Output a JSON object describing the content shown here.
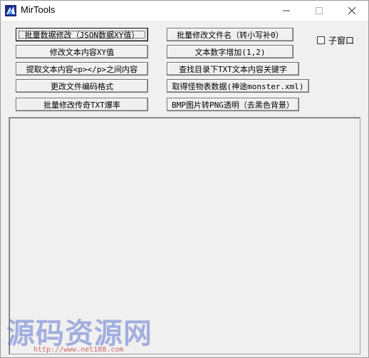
{
  "window": {
    "title": "MirTools"
  },
  "colors": {
    "window_bg": "#f0f0f0",
    "titlebar_bg": "#ffffff",
    "watermark": "#6478d2",
    "watermark_url": "#c84646"
  },
  "buttons": {
    "batch_modify_data": "批量数据修改（JSON数据XY值）",
    "batch_rename": "批量修改文件名（转小写补0）",
    "modify_xy": "修改文本内容XY值",
    "text_num_add": "文本数字增加(1,2)",
    "extract_p": "提取文本内容<p></p>之间内容",
    "search_txt": "查找目录下TXT文本内容关键字",
    "change_encoding": "更改文件编码格式",
    "get_monster": "取得怪物表数据(神途monster.xml)",
    "batch_drop_rate": "批量修改传奇TXT爆率",
    "bmp_to_png": "BMP图片转PNG透明（去黑色背景）"
  },
  "checkbox": {
    "label": "子窗口",
    "checked": false
  },
  "watermark": {
    "text": "源码资源网",
    "url": "http://www.net188.com"
  }
}
